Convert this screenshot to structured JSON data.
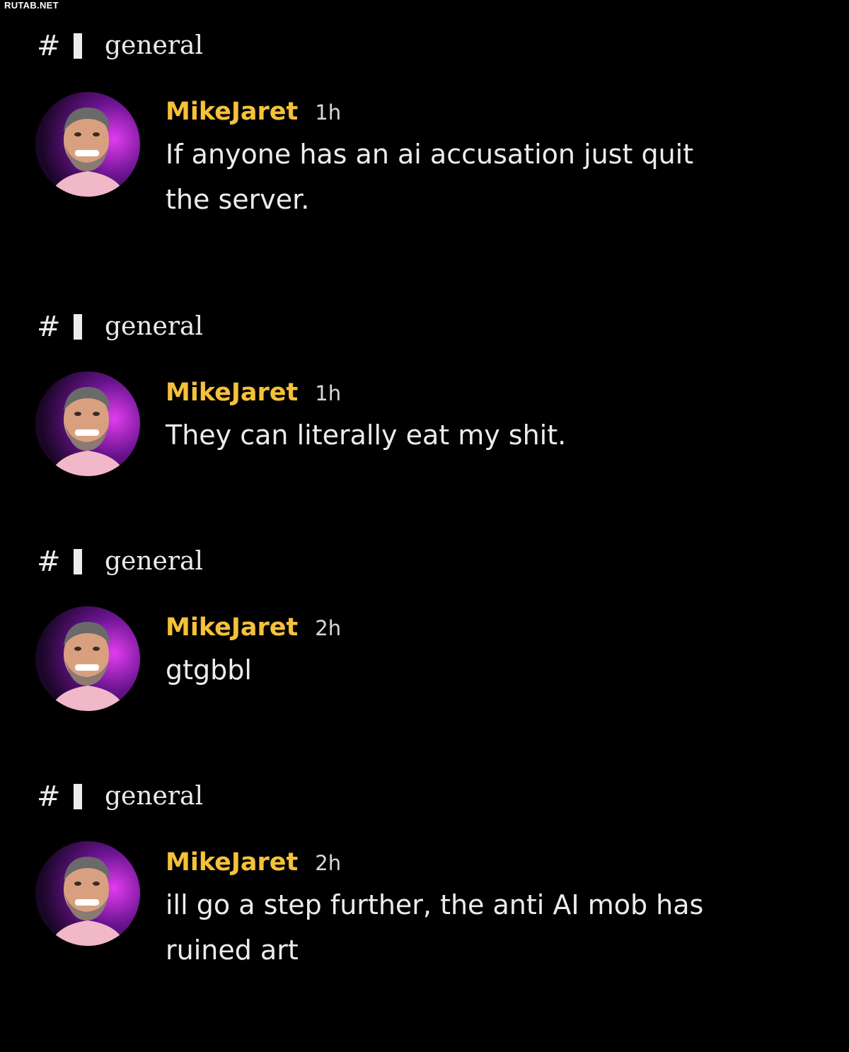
{
  "watermark": "RUTAB.NET",
  "colors": {
    "background": "#000000",
    "author": "#f5c13a",
    "text": "#ececec"
  },
  "messages": [
    {
      "channel": "general",
      "author": "MikeJaret",
      "time": "1h",
      "text": "If anyone has an ai accusation just quit the server."
    },
    {
      "channel": "general",
      "author": "MikeJaret",
      "time": "1h",
      "text": "They can literally eat my shit."
    },
    {
      "channel": "general",
      "author": "MikeJaret",
      "time": "2h",
      "text": "gtgbbl"
    },
    {
      "channel": "general",
      "author": "MikeJaret",
      "time": "2h",
      "text": "ill go a step further, the anti AI mob has ruined art"
    }
  ]
}
